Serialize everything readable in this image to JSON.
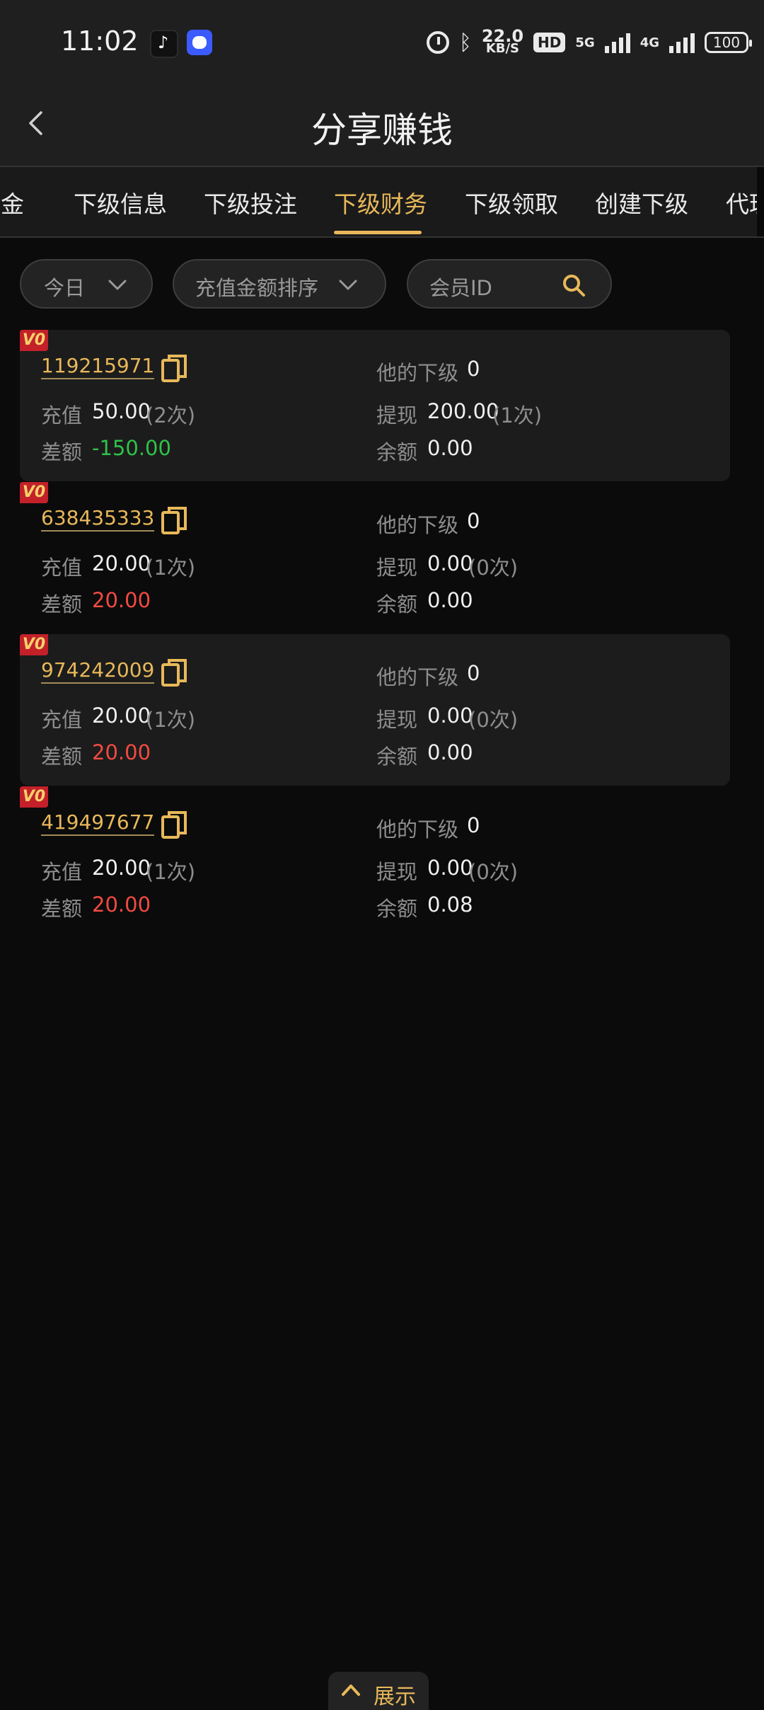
{
  "status_bar": {
    "time": "11:02",
    "speed_value": "22.0",
    "speed_unit": "KB/S",
    "hd": "HD",
    "net_5g": "5G",
    "net_4g": "4G",
    "battery": "100"
  },
  "header": {
    "title": "分享赚钱"
  },
  "tabs": [
    {
      "label": "佣金"
    },
    {
      "label": "下级信息"
    },
    {
      "label": "下级投注"
    },
    {
      "label": "下级财务",
      "active": true
    },
    {
      "label": "下级领取"
    },
    {
      "label": "创建下级"
    },
    {
      "label": "代理"
    }
  ],
  "filters": {
    "date_label": "今日",
    "sort_label": "充值金额排序",
    "search_placeholder": "会员ID"
  },
  "labels": {
    "sub": "他的下级",
    "recharge": "充值",
    "withdraw": "提现",
    "diff": "差额",
    "balance": "余额"
  },
  "members": [
    {
      "badge": "V0",
      "id": "119215971",
      "sub_count": "0",
      "recharge": "50.00",
      "recharge_times": "(2次)",
      "withdraw": "200.00",
      "withdraw_times": "(1次)",
      "diff": "-150.00",
      "balance": "0.00"
    },
    {
      "badge": "V0",
      "id": "638435333",
      "sub_count": "0",
      "recharge": "20.00",
      "recharge_times": "(1次)",
      "withdraw": "0.00",
      "withdraw_times": "(0次)",
      "diff": "20.00",
      "balance": "0.00"
    },
    {
      "badge": "V0",
      "id": "974242009",
      "sub_count": "0",
      "recharge": "20.00",
      "recharge_times": "(1次)",
      "withdraw": "0.00",
      "withdraw_times": "(0次)",
      "diff": "20.00",
      "balance": "0.00"
    },
    {
      "badge": "V0",
      "id": "419497677",
      "sub_count": "0",
      "recharge": "20.00",
      "recharge_times": "(1次)",
      "withdraw": "0.00",
      "withdraw_times": "(0次)",
      "diff": "20.00",
      "balance": "0.08"
    }
  ],
  "bottom": {
    "show_label": "展示"
  },
  "colors": {
    "accent": "#e8b85a",
    "negative": "#2ec24a",
    "positive": "#f24a42",
    "badge": "#c3202a"
  }
}
